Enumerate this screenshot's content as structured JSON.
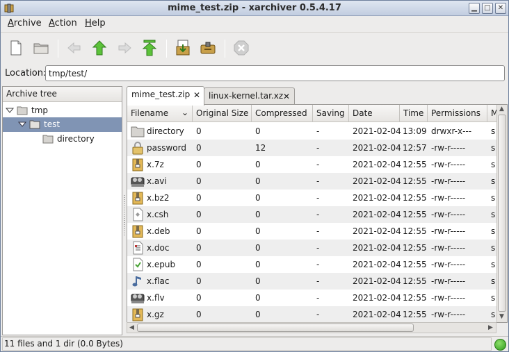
{
  "window": {
    "title": "mime_test.zip - xarchiver 0.5.4.17"
  },
  "menu": [
    {
      "label": "Archive",
      "mnemonic": "A",
      "rest": "rchive"
    },
    {
      "label": "Action",
      "mnemonic": "A",
      "rest": "ction"
    },
    {
      "label": "Help",
      "mnemonic": "H",
      "rest": "elp"
    }
  ],
  "toolbar": {
    "icons": [
      "new-archive-icon",
      "open-archive-icon",
      "back-icon",
      "up-icon",
      "forward-icon",
      "home-icon",
      "extract-icon",
      "add-icon",
      "stop-icon"
    ]
  },
  "location": {
    "label": "Location:",
    "value": "tmp/test/"
  },
  "tree": {
    "header": "Archive tree",
    "items": [
      {
        "label": "tmp"
      },
      {
        "label": "test"
      },
      {
        "label": "directory"
      }
    ]
  },
  "tabs": [
    {
      "label": "mime_test.zip"
    },
    {
      "label": "linux-kernel.tar.xz"
    }
  ],
  "columns": [
    "Filename",
    "Original Size",
    "Compressed",
    "Saving",
    "Date",
    "Time",
    "Permissions",
    "M"
  ],
  "rows": [
    {
      "icon": "folder-icon",
      "name": "directory",
      "orig": "0",
      "comp": "0",
      "saving": "-",
      "date": "2021-02-04",
      "time": "13:09",
      "perm": "drwxr-x---",
      "m": "s"
    },
    {
      "icon": "lock-icon",
      "name": "password",
      "orig": "0",
      "comp": "12",
      "saving": "-",
      "date": "2021-02-04",
      "time": "12:57",
      "perm": "-rw-r-----",
      "m": "s"
    },
    {
      "icon": "archive-icon",
      "name": "x.7z",
      "orig": "0",
      "comp": "0",
      "saving": "-",
      "date": "2021-02-04",
      "time": "12:55",
      "perm": "-rw-r-----",
      "m": "s"
    },
    {
      "icon": "film-icon",
      "name": "x.avi",
      "orig": "0",
      "comp": "0",
      "saving": "-",
      "date": "2021-02-04",
      "time": "12:55",
      "perm": "-rw-r-----",
      "m": "s"
    },
    {
      "icon": "archive-icon",
      "name": "x.bz2",
      "orig": "0",
      "comp": "0",
      "saving": "-",
      "date": "2021-02-04",
      "time": "12:55",
      "perm": "-rw-r-----",
      "m": "s"
    },
    {
      "icon": "script-icon",
      "name": "x.csh",
      "orig": "0",
      "comp": "0",
      "saving": "-",
      "date": "2021-02-04",
      "time": "12:55",
      "perm": "-rw-r-----",
      "m": "s"
    },
    {
      "icon": "archive-icon",
      "name": "x.deb",
      "orig": "0",
      "comp": "0",
      "saving": "-",
      "date": "2021-02-04",
      "time": "12:55",
      "perm": "-rw-r-----",
      "m": "s"
    },
    {
      "icon": "document-icon",
      "name": "x.doc",
      "orig": "0",
      "comp": "0",
      "saving": "-",
      "date": "2021-02-04",
      "time": "12:55",
      "perm": "-rw-r-----",
      "m": "s"
    },
    {
      "icon": "ebook-icon",
      "name": "x.epub",
      "orig": "0",
      "comp": "0",
      "saving": "-",
      "date": "2021-02-04",
      "time": "12:55",
      "perm": "-rw-r-----",
      "m": "s"
    },
    {
      "icon": "music-icon",
      "name": "x.flac",
      "orig": "0",
      "comp": "0",
      "saving": "-",
      "date": "2021-02-04",
      "time": "12:55",
      "perm": "-rw-r-----",
      "m": "s"
    },
    {
      "icon": "film-icon",
      "name": "x.flv",
      "orig": "0",
      "comp": "0",
      "saving": "-",
      "date": "2021-02-04",
      "time": "12:55",
      "perm": "-rw-r-----",
      "m": "s"
    },
    {
      "icon": "archive-icon",
      "name": "x.gz",
      "orig": "0",
      "comp": "0",
      "saving": "-",
      "date": "2021-02-04",
      "time": "12:55",
      "perm": "-rw-r-----",
      "m": "s"
    }
  ],
  "status": {
    "text": "11 files and 1 dir (0.0 Bytes)"
  }
}
